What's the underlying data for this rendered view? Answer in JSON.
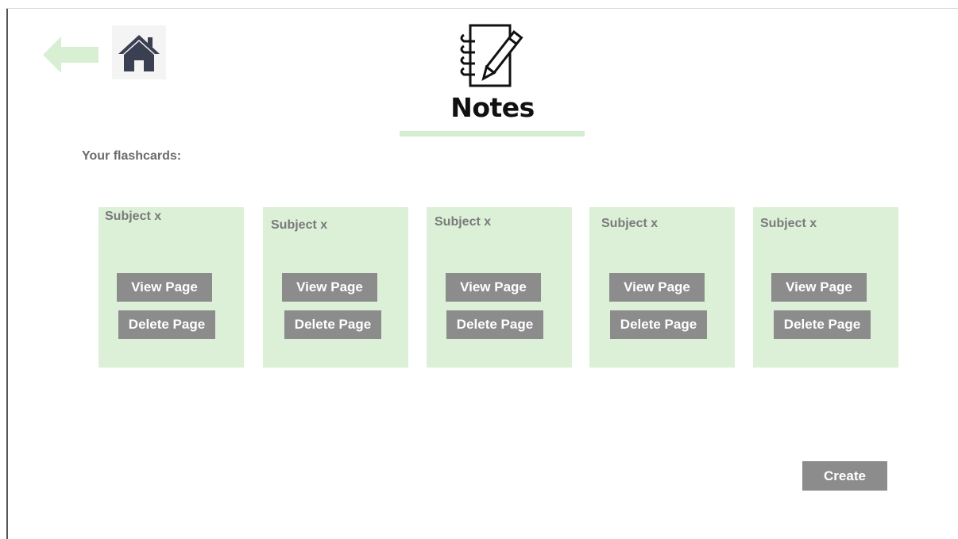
{
  "header": {
    "logo_title": "Notes",
    "back_icon": "arrow-left-icon",
    "home_icon": "home-icon",
    "logo_icon": "notebook-pencil-icon"
  },
  "main": {
    "section_label": "Your flashcards:",
    "cards": [
      {
        "title": "Subject x",
        "view_label": "View Page",
        "delete_label": "Delete Page"
      },
      {
        "title": "Subject x",
        "view_label": "View Page",
        "delete_label": "Delete Page"
      },
      {
        "title": "Subject x",
        "view_label": "View Page",
        "delete_label": "Delete Page"
      },
      {
        "title": "Subject x",
        "view_label": "View Page",
        "delete_label": "Delete Page"
      },
      {
        "title": "Subject x",
        "view_label": "View Page",
        "delete_label": "Delete Page"
      }
    ],
    "create_label": "Create"
  },
  "colors": {
    "card_background": "#dcf0d8",
    "button_background": "#8c8c8c",
    "accent_green": "#d4eed4",
    "home_icon": "#3a3f52"
  }
}
